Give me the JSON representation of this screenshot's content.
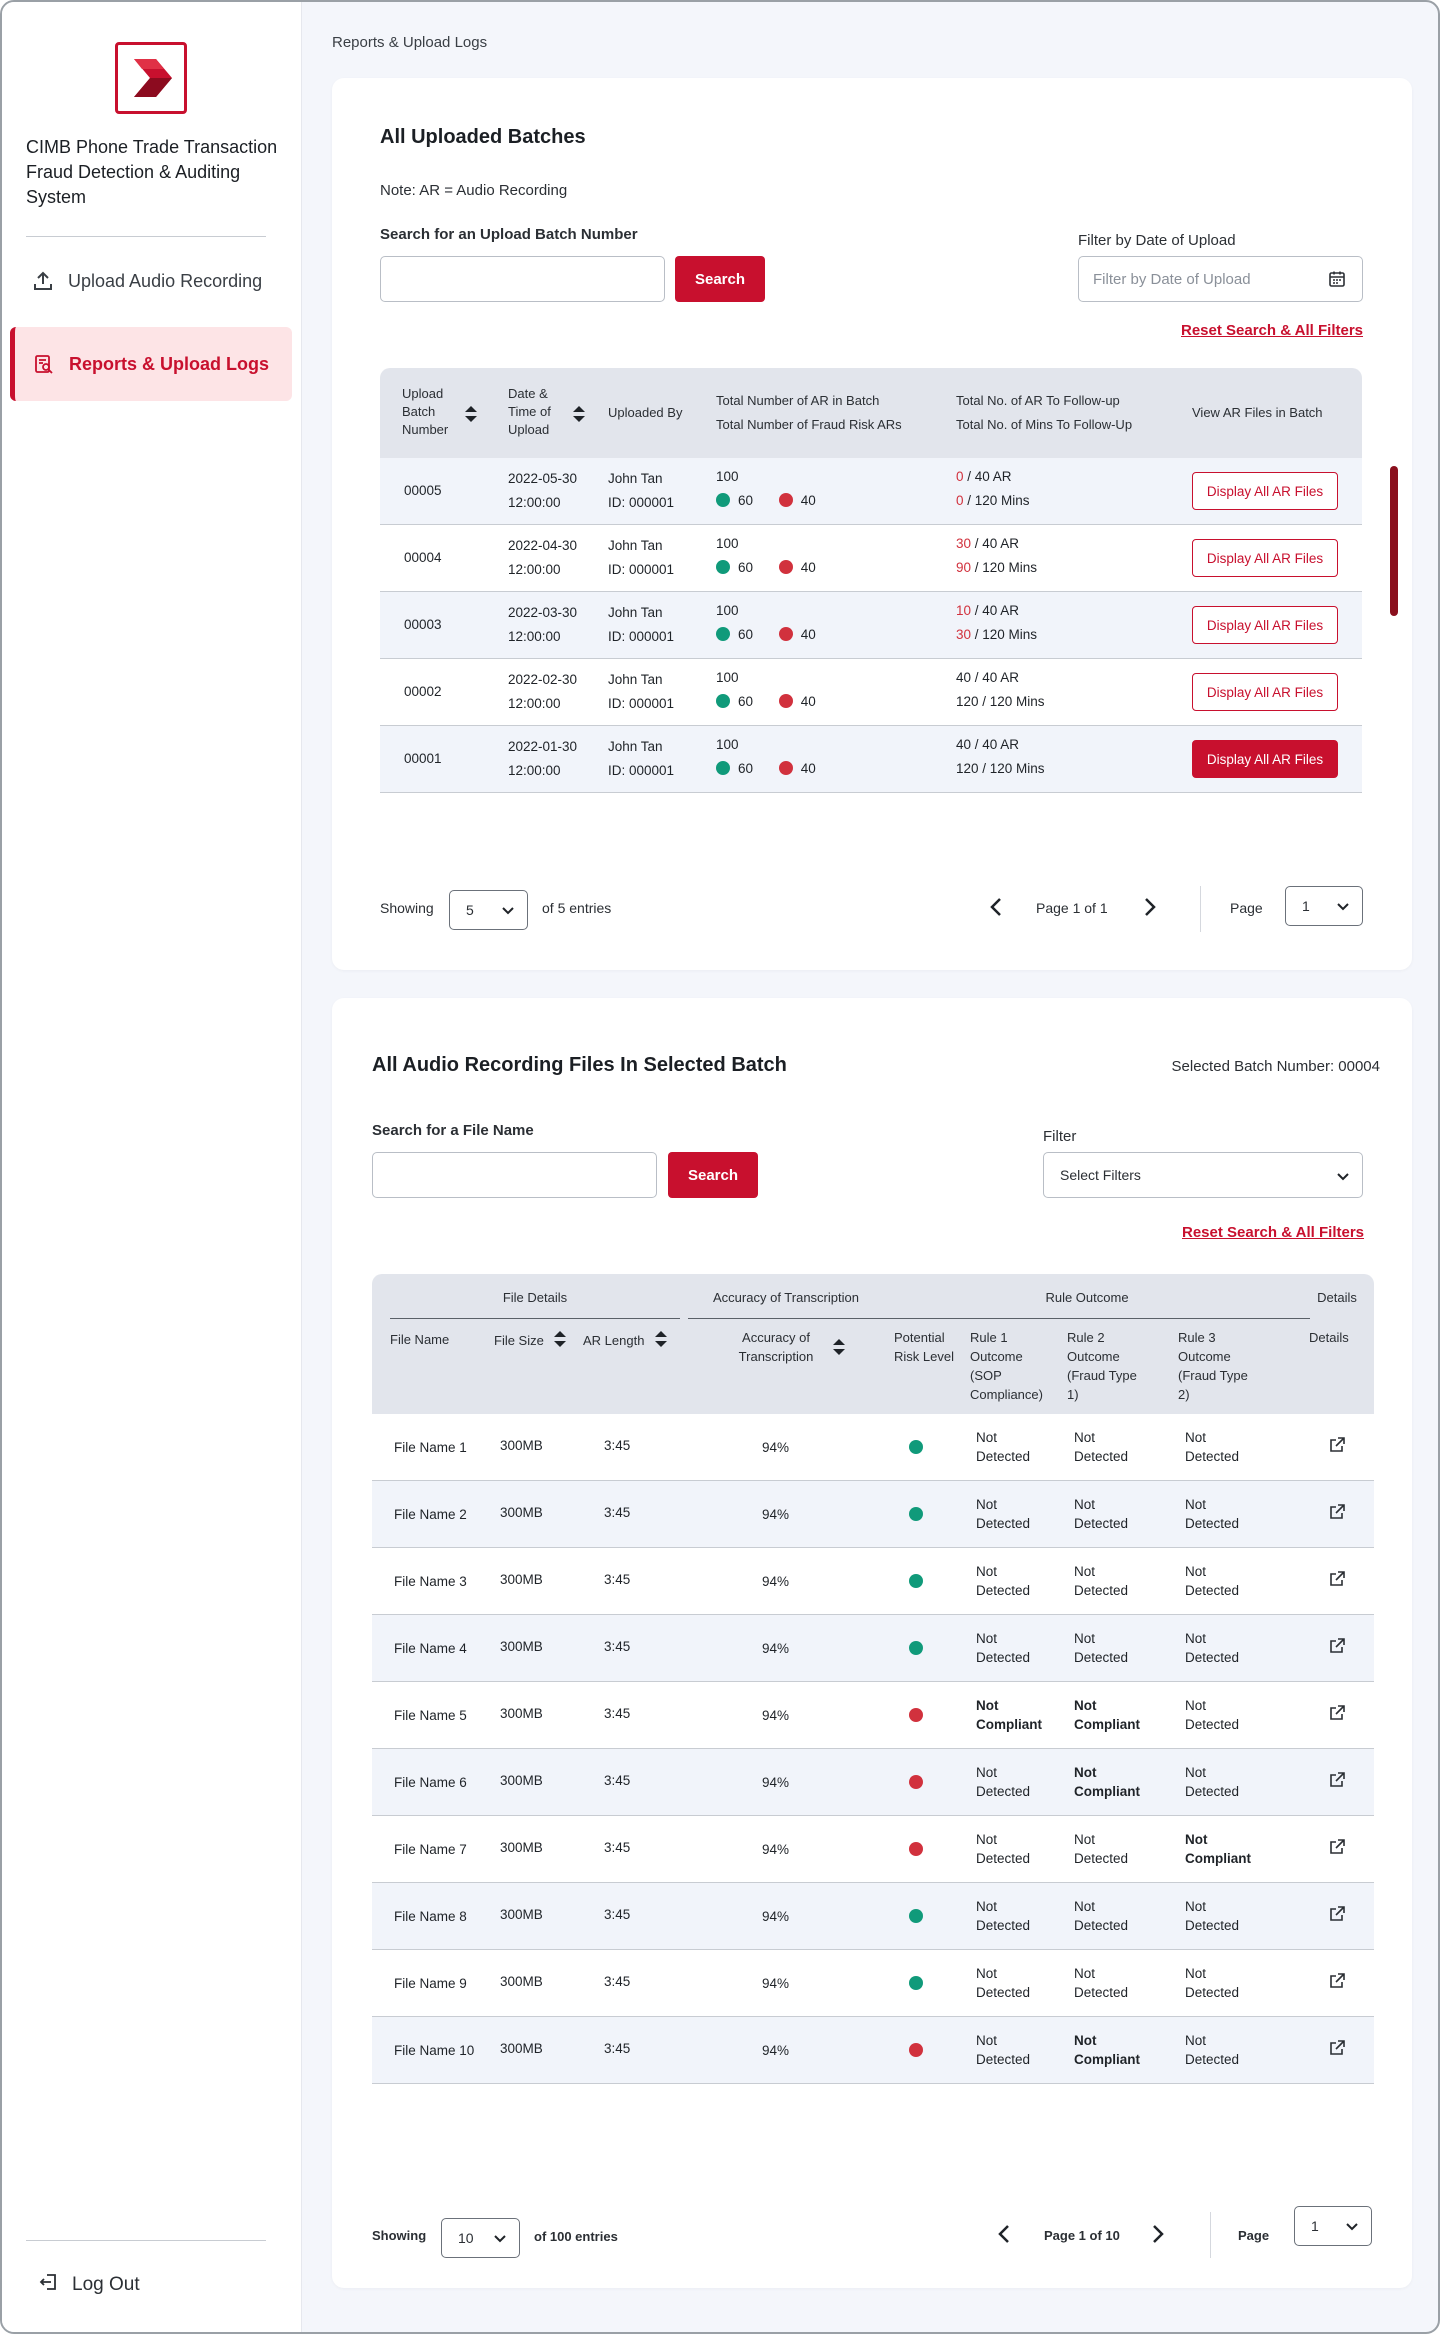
{
  "app": {
    "title": "CIMB Phone Trade Transaction Fraud Detection & Auditing System",
    "brand_color": "#c8102e"
  },
  "sidebar": {
    "items": [
      {
        "label": "Upload Audio Recording",
        "icon": "upload-icon"
      },
      {
        "label": "Reports & Upload Logs",
        "icon": "report-search-icon",
        "active": true
      }
    ],
    "logout_label": "Log Out"
  },
  "breadcrumb": "Reports & Upload Logs",
  "batches": {
    "title": "All Uploaded Batches",
    "note": "Note: AR = Audio Recording",
    "search_label": "Search for an Upload Batch Number",
    "search_value": "",
    "search_button": "Search",
    "filter_label": "Filter by Date of Upload",
    "filter_placeholder": "Filter by Date of Upload",
    "reset_link": "Reset Search & All Filters",
    "headers": {
      "batch_number": "Upload Batch Number",
      "date_time": "Date & Time of Upload",
      "uploaded_by": "Uploaded By",
      "total_ar": "Total Number of AR in Batch",
      "total_fraud": "Total Number of Fraud Risk ARs",
      "followup_ar": "Total No. of AR To Follow-up",
      "followup_mins": "Total No. of Mins To Follow-Up",
      "view": "View AR Files in Batch"
    },
    "rows": [
      {
        "batch": "00005",
        "date": "2022-05-30",
        "time": "12:00:00",
        "user": "John Tan",
        "user_id": "ID: 000001",
        "total": "100",
        "green": "60",
        "red": "40",
        "ar_done": "0",
        "ar_total": " / 40 AR",
        "min_done": "0",
        "min_total": " / 120 Mins",
        "ar_red": true,
        "min_red": true,
        "button": "Display All AR Files",
        "selected": false
      },
      {
        "batch": "00004",
        "date": "2022-04-30",
        "time": "12:00:00",
        "user": "John Tan",
        "user_id": "ID: 000001",
        "total": "100",
        "green": "60",
        "red": "40",
        "ar_done": "30",
        "ar_total": " / 40 AR",
        "min_done": "90",
        "min_total": " / 120 Mins",
        "ar_red": true,
        "min_red": true,
        "button": "Display All AR Files",
        "selected": false
      },
      {
        "batch": "00003",
        "date": "2022-03-30",
        "time": "12:00:00",
        "user": "John Tan",
        "user_id": "ID: 000001",
        "total": "100",
        "green": "60",
        "red": "40",
        "ar_done": "10",
        "ar_total": " / 40 AR",
        "min_done": "30",
        "min_total": " / 120 Mins",
        "ar_red": true,
        "min_red": true,
        "button": "Display All AR Files",
        "selected": false
      },
      {
        "batch": "00002",
        "date": "2022-02-30",
        "time": "12:00:00",
        "user": "John Tan",
        "user_id": "ID: 000001",
        "total": "100",
        "green": "60",
        "red": "40",
        "ar_done": "40",
        "ar_total": " / 40 AR",
        "min_done": "120",
        "min_total": " / 120 Mins",
        "ar_red": false,
        "min_red": false,
        "button": "Display All AR Files",
        "selected": false
      },
      {
        "batch": "00001",
        "date": "2022-01-30",
        "time": "12:00:00",
        "user": "John Tan",
        "user_id": "ID: 000001",
        "total": "100",
        "green": "60",
        "red": "40",
        "ar_done": "40",
        "ar_total": " / 40 AR",
        "min_done": "120",
        "min_total": " / 120 Mins",
        "ar_red": false,
        "min_red": false,
        "button": "Display All AR Files",
        "selected": true
      }
    ],
    "pagination": {
      "showing": "Showing",
      "page_size": "5",
      "of_entries": "of 5 entries",
      "page_info": "Page 1 of 1",
      "page_label": "Page",
      "page_value": "1"
    }
  },
  "files": {
    "title": "All Audio Recording Files In Selected Batch",
    "selected_batch": "Selected Batch Number: 00004",
    "search_label": "Search for a File Name",
    "search_value": "",
    "search_button": "Search",
    "filter_label": "Filter",
    "filter_value": "Select Filters",
    "reset_link": "Reset Search & All Filters",
    "groups": {
      "file_details": "File Details",
      "accuracy": "Accuracy of Transcription",
      "rule_outcome": "Rule Outcome",
      "details": "Details"
    },
    "headers": {
      "file_name": "File Name",
      "file_size": "File Size",
      "ar_length": "AR Length",
      "accuracy": "Accuracy of Transcription",
      "risk": "Potential Risk Level",
      "rule1": "Rule 1 Outcome (SOP Compliance)",
      "rule2": "Rule 2 Outcome (Fraud Type 1)",
      "rule3": "Rule 3 Outcome (Fraud Type 2)",
      "details": "Details"
    },
    "rows": [
      {
        "name": "File Name 1",
        "size": "300MB",
        "length": "3:45",
        "accuracy": "94%",
        "risk": "green",
        "r1a": "Not",
        "r1b": "Detected",
        "r1bold": false,
        "r2a": "Not",
        "r2b": "Detected",
        "r2bold": false,
        "r3a": "Not",
        "r3b": "Detected",
        "r3bold": false
      },
      {
        "name": "File Name 2",
        "size": "300MB",
        "length": "3:45",
        "accuracy": "94%",
        "risk": "green",
        "r1a": "Not",
        "r1b": "Detected",
        "r1bold": false,
        "r2a": "Not",
        "r2b": "Detected",
        "r2bold": false,
        "r3a": "Not",
        "r3b": "Detected",
        "r3bold": false
      },
      {
        "name": "File Name 3",
        "size": "300MB",
        "length": "3:45",
        "accuracy": "94%",
        "risk": "green",
        "r1a": "Not",
        "r1b": "Detected",
        "r1bold": false,
        "r2a": "Not",
        "r2b": "Detected",
        "r2bold": false,
        "r3a": "Not",
        "r3b": "Detected",
        "r3bold": false
      },
      {
        "name": "File Name 4",
        "size": "300MB",
        "length": "3:45",
        "accuracy": "94%",
        "risk": "green",
        "r1a": "Not",
        "r1b": "Detected",
        "r1bold": false,
        "r2a": "Not",
        "r2b": "Detected",
        "r2bold": false,
        "r3a": "Not",
        "r3b": "Detected",
        "r3bold": false
      },
      {
        "name": "File Name 5",
        "size": "300MB",
        "length": "3:45",
        "accuracy": "94%",
        "risk": "red",
        "r1a": "Not",
        "r1b": "Compliant",
        "r1bold": true,
        "r2a": "Not",
        "r2b": "Compliant",
        "r2bold": true,
        "r3a": "Not",
        "r3b": "Detected",
        "r3bold": false
      },
      {
        "name": "File Name 6",
        "size": "300MB",
        "length": "3:45",
        "accuracy": "94%",
        "risk": "red",
        "r1a": "Not",
        "r1b": "Detected",
        "r1bold": false,
        "r2a": "Not",
        "r2b": "Compliant",
        "r2bold": true,
        "r3a": "Not",
        "r3b": "Detected",
        "r3bold": false
      },
      {
        "name": "File Name 7",
        "size": "300MB",
        "length": "3:45",
        "accuracy": "94%",
        "risk": "red",
        "r1a": "Not",
        "r1b": "Detected",
        "r1bold": false,
        "r2a": "Not",
        "r2b": "Detected",
        "r2bold": false,
        "r3a": "Not",
        "r3b": "Compliant",
        "r3bold": true
      },
      {
        "name": "File Name 8",
        "size": "300MB",
        "length": "3:45",
        "accuracy": "94%",
        "risk": "green",
        "r1a": "Not",
        "r1b": "Detected",
        "r1bold": false,
        "r2a": "Not",
        "r2b": "Detected",
        "r2bold": false,
        "r3a": "Not",
        "r3b": "Detected",
        "r3bold": false
      },
      {
        "name": "File Name 9",
        "size": "300MB",
        "length": "3:45",
        "accuracy": "94%",
        "risk": "green",
        "r1a": "Not",
        "r1b": "Detected",
        "r1bold": false,
        "r2a": "Not",
        "r2b": "Detected",
        "r2bold": false,
        "r3a": "Not",
        "r3b": "Detected",
        "r3bold": false
      },
      {
        "name": "File Name 10",
        "size": "300MB",
        "length": "3:45",
        "accuracy": "94%",
        "risk": "red",
        "r1a": "Not",
        "r1b": "Detected",
        "r1bold": false,
        "r2a": "Not",
        "r2b": "Compliant",
        "r2bold": true,
        "r3a": "Not",
        "r3b": "Detected",
        "r3bold": false
      }
    ],
    "pagination": {
      "showing": "Showing",
      "page_size": "10",
      "of_entries": "of 100 entries",
      "page_info": "Page 1 of 10",
      "page_label": "Page",
      "page_value": "1"
    }
  },
  "colors": {
    "risk_green": "#109a7a",
    "risk_red": "#d1313d"
  }
}
